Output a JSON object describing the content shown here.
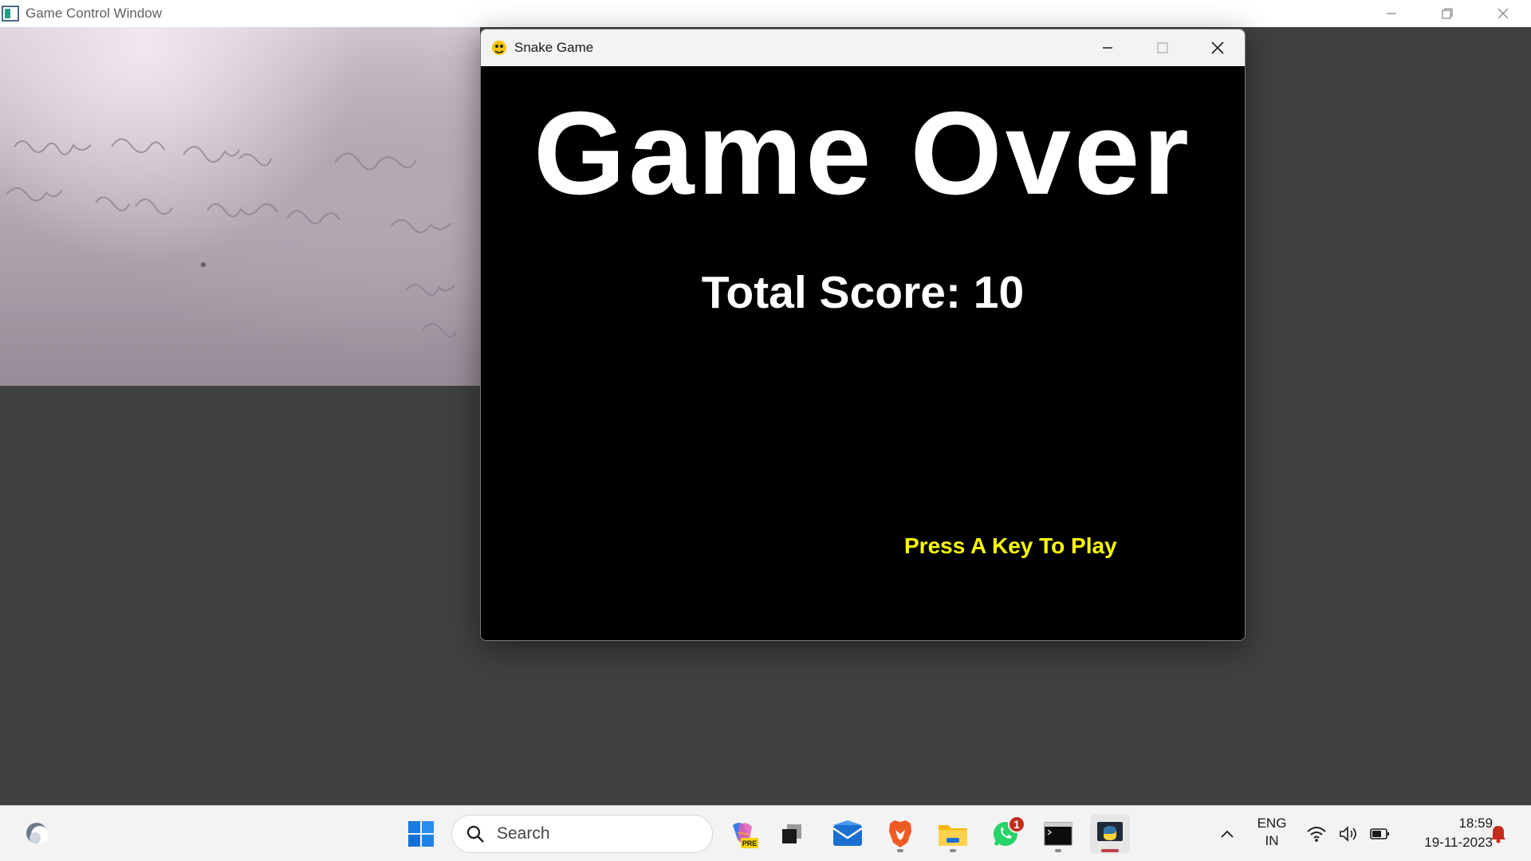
{
  "background_window": {
    "title": "Game Control Window"
  },
  "snake_window": {
    "title": "Snake Game",
    "game_over_text": "Game Over",
    "score_text": "Total Score: 10",
    "prompt_text": "Press A Key To Play",
    "prompt_color": "#ffff00",
    "background_color": "#000000"
  },
  "taskbar": {
    "search_placeholder": "Search",
    "pinned_apps": [
      {
        "name": "start-button",
        "icon": "windows-logo"
      },
      {
        "name": "copilot",
        "icon": "copilot-icon",
        "badge_text": "PRE"
      },
      {
        "name": "task-view",
        "icon": "task-view-icon"
      },
      {
        "name": "mail",
        "icon": "mail-icon"
      },
      {
        "name": "brave",
        "icon": "brave-icon"
      },
      {
        "name": "file-explorer",
        "icon": "folder-icon"
      },
      {
        "name": "whatsapp",
        "icon": "whatsapp-icon",
        "notification_count": "1"
      },
      {
        "name": "terminal",
        "icon": "terminal-icon"
      },
      {
        "name": "python",
        "icon": "python-icon"
      }
    ],
    "tray": {
      "lang_line1": "ENG",
      "lang_line2": "IN",
      "time": "18:59",
      "date": "19-11-2023"
    }
  }
}
